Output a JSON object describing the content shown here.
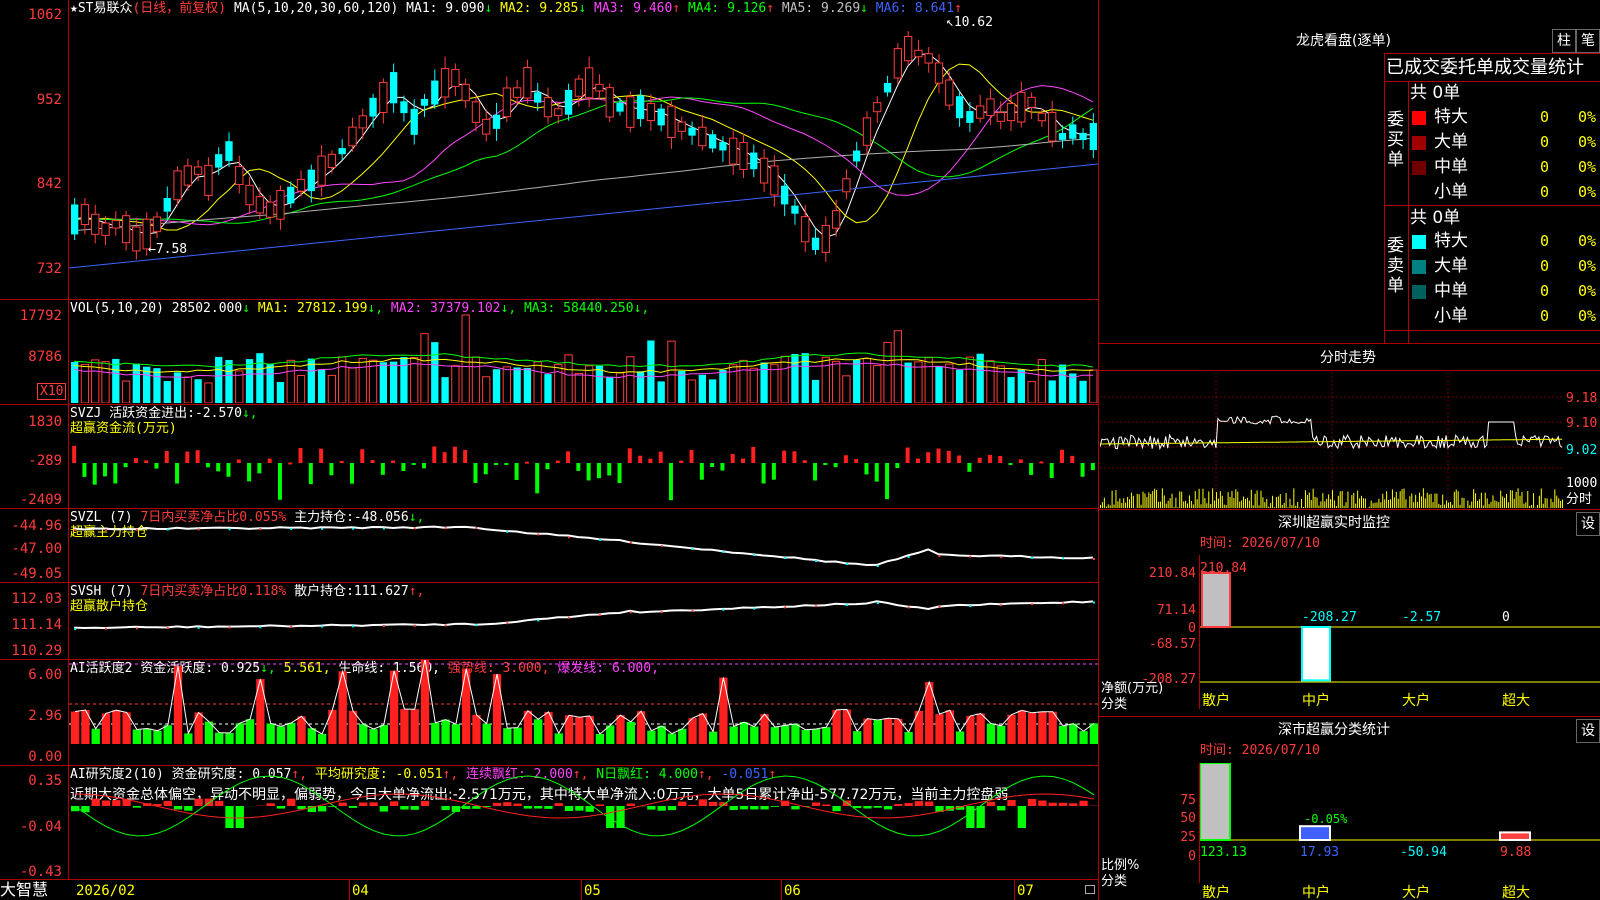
{
  "app": {
    "brand": "大智慧"
  },
  "main": {
    "ticker": "★ST易联众",
    "mode": "(日线，前复权)",
    "ma_title": "MA(5,10,20,30,60,120)",
    "ma": [
      {
        "label": "MA1:",
        "value": "9.090",
        "arrow": "↓",
        "color": "#ffffff"
      },
      {
        "label": "MA2:",
        "value": "9.285",
        "arrow": "↓",
        "color": "#ffff00"
      },
      {
        "label": "MA3:",
        "value": "9.460",
        "arrow": "↑",
        "color": "#ff44ff"
      },
      {
        "label": "MA4:",
        "value": "9.126",
        "arrow": "↑",
        "color": "#00ff00"
      },
      {
        "label": "MA5:",
        "value": "9.269",
        "arrow": "↓",
        "color": "#c0c0c0"
      },
      {
        "label": "MA6:",
        "value": "8.641",
        "arrow": "↑",
        "color": "#3c64ff"
      }
    ],
    "yticks": [
      "1062",
      "952",
      "842",
      "732"
    ],
    "high_label": "10.62",
    "low_label": "7.58"
  },
  "vol": {
    "title": "VOL(5,10,20)",
    "value": "28502.000",
    "arrow": "↓",
    "ma": [
      {
        "label": "MA1:",
        "value": "27812.199",
        "arrow": "↓",
        "color": "#ffff00"
      },
      {
        "label": "MA2:",
        "value": "37379.102",
        "arrow": "↓",
        "color": "#ff44ff"
      },
      {
        "label": "MA3:",
        "value": "58440.250",
        "arrow": "↓",
        "color": "#00ff00"
      }
    ],
    "yticks": [
      "17792",
      "8786"
    ],
    "unit": "X10"
  },
  "svzj": {
    "title": "SVZJ",
    "label": "活跃资金进出:",
    "value": "-2.570",
    "arrow": "↓,",
    "subtitle": "超赢资金流(万元)",
    "yticks": [
      "1830",
      "-289",
      "-2409"
    ]
  },
  "svzl": {
    "title": "SVZL (7)",
    "desc": "7日内买卖净占比0.055%",
    "label": "主力持仓:",
    "value": "-48.056",
    "arrow": "↓,",
    "subtitle": "超赢主力持仓",
    "yticks": [
      "-44.96",
      "-47.00",
      "-49.05"
    ]
  },
  "svsh": {
    "title": "SVSH (7)",
    "desc": "7日内买卖净占比0.118%",
    "label": "散户持仓:",
    "value": "111.627",
    "arrow": "↑,",
    "subtitle": "超赢散户持仓",
    "yticks": [
      "112.03",
      "111.14",
      "110.29"
    ]
  },
  "ai1": {
    "title": "AI活跃度2",
    "label": "资金活跃度:",
    "value": "0.925",
    "arrow": "↓,",
    "v2": "5.561,",
    "life_label": "生命线:",
    "life_value": "1.560,",
    "strong": "强势线: 3.000,",
    "burst": "爆发线: 6.000,",
    "yticks": [
      "6.00",
      "2.96",
      "0.00"
    ]
  },
  "ai2": {
    "title": "AI研究度2(10)",
    "label": "资金研究度:",
    "value": "0.057",
    "arrow": "↑,",
    "avg": "平均研究度: -0.051",
    "avg_arrow": "↑,",
    "cons": "连续飘红: 2.000",
    "cons_arrow": "↑,",
    "nday": "N日飘红: 4.000",
    "nday_arrow": "↑,",
    "last": "-0.051",
    "last_arrow": "↑",
    "summary": "近期大资金总体偏空，异动不明显，偏弱势，今日大单净流出:-2.571万元，其中特大单净流入:0万元，大单5日累计净出-577.72万元，当前主力控盘弱",
    "yticks": [
      "0.35",
      "-0.04",
      "-0.43"
    ]
  },
  "xaxis": [
    "2026/02",
    "04",
    "05",
    "06",
    "07"
  ],
  "right": {
    "longhu": {
      "title": "龙虎看盘(逐单)",
      "btn1": "柱",
      "btn2": "笔",
      "header": "已成交委托单成交量统计",
      "buy_label": "委买单",
      "sell_label": "委卖单",
      "buy_total": "共 0单",
      "sell_total": "共 0单",
      "buy_rows": [
        {
          "name": "特大",
          "num": "0",
          "pct": "0%",
          "color": "#ff0000"
        },
        {
          "name": "大单",
          "num": "0",
          "pct": "0%",
          "color": "#a00000"
        },
        {
          "name": "中单",
          "num": "0",
          "pct": "0%",
          "color": "#700000"
        },
        {
          "name": "小单",
          "num": "0",
          "pct": "0%",
          "color": ""
        }
      ],
      "sell_rows": [
        {
          "name": "特大",
          "num": "0",
          "pct": "0%",
          "color": "#00ffff"
        },
        {
          "name": "大单",
          "num": "0",
          "pct": "0%",
          "color": "#008080"
        },
        {
          "name": "中单",
          "num": "0",
          "pct": "0%",
          "color": "#006060"
        },
        {
          "name": "小单",
          "num": "0",
          "pct": "0%",
          "color": ""
        }
      ]
    },
    "intraday": {
      "title": "分时走势",
      "yticks": [
        "9.18",
        "9.10",
        "9.02"
      ],
      "vol_tick": "1000",
      "vol_label": "分时"
    },
    "monitor": {
      "title": "深圳超赢实时监控",
      "btn": "设",
      "time": "时间: 2026/07/10",
      "yticks": [
        "210.84",
        "71.14",
        "0",
        "-68.57",
        "-208.27"
      ],
      "ylabel1": "净额(万元)",
      "ylabel2": "分类",
      "cats": [
        "散户",
        "中户",
        "大户",
        "超大"
      ],
      "values": [
        "210.84",
        "-208.27",
        "-2.57",
        "0"
      ]
    },
    "classify": {
      "title": "深市超赢分类统计",
      "btn": "设",
      "time": "时间: 2026/07/10",
      "yticks": [
        "75",
        "50",
        "25",
        "0"
      ],
      "ylabel1": "比例%",
      "ylabel2": "分类",
      "cats": [
        "散户",
        "中户",
        "大户",
        "超大"
      ],
      "values": [
        "123.13",
        "17.93",
        "-50.94",
        "9.88"
      ],
      "pct_label": "-0.05%"
    }
  }
}
